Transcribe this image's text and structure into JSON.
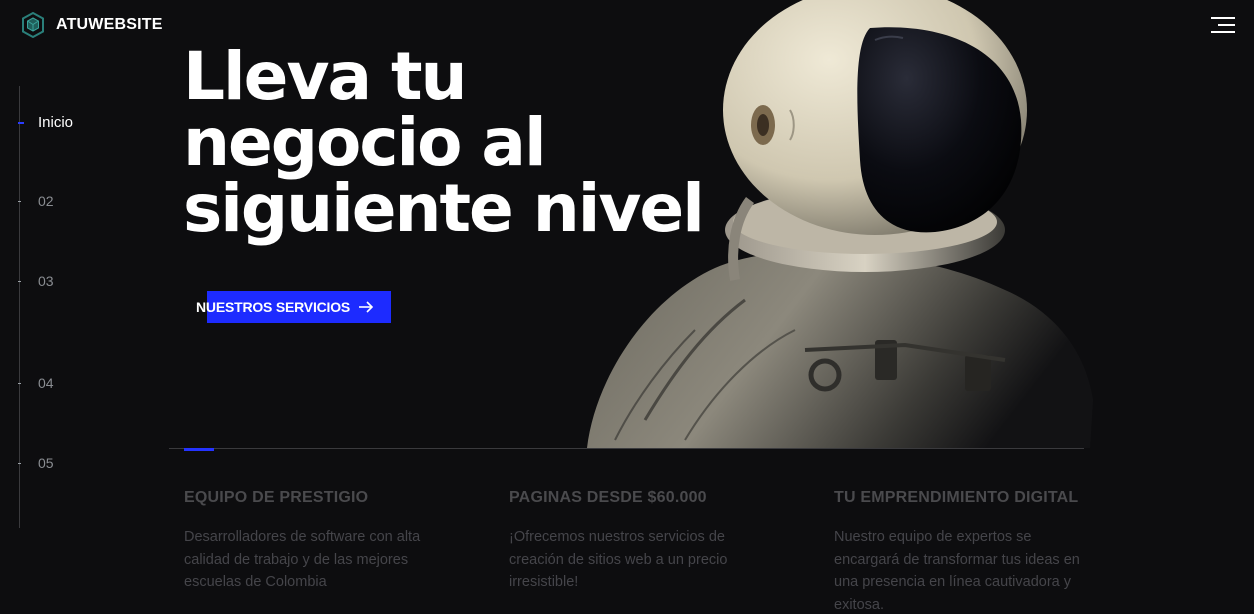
{
  "brand": {
    "name": "ATUWEBSITE",
    "icon": "cube-logo-icon",
    "accent_color": "#2a7f7a"
  },
  "header": {
    "menu_icon": "hamburger-menu-icon"
  },
  "side_nav": {
    "items": [
      {
        "label": "Inicio",
        "active": true
      },
      {
        "label": "02",
        "active": false
      },
      {
        "label": "03",
        "active": false
      },
      {
        "label": "04",
        "active": false
      },
      {
        "label": "05",
        "active": false
      }
    ]
  },
  "hero": {
    "title_lines": [
      "Lleva tu",
      "negocio al",
      "siguiente nivel"
    ],
    "cta_label": "NUESTROS SERVICIOS",
    "cta_icon": "arrow-right-icon",
    "cta_color": "#1d2bff"
  },
  "features": [
    {
      "title": "EQUIPO DE PRESTIGIO",
      "text": "Desarrolladores de software con alta calidad de trabajo y de las mejores escuelas de Colombia"
    },
    {
      "title": "PAGINAS DESDE $60.000",
      "text": "¡Ofrecemos nuestros servicios de creación de sitios web a un precio irresistible!"
    },
    {
      "title": "TU EMPRENDIMIENTO DIGITAL",
      "text": "Nuestro equipo de expertos se encargará de transformar tus ideas en una presencia en línea cautivadora y exitosa."
    }
  ]
}
